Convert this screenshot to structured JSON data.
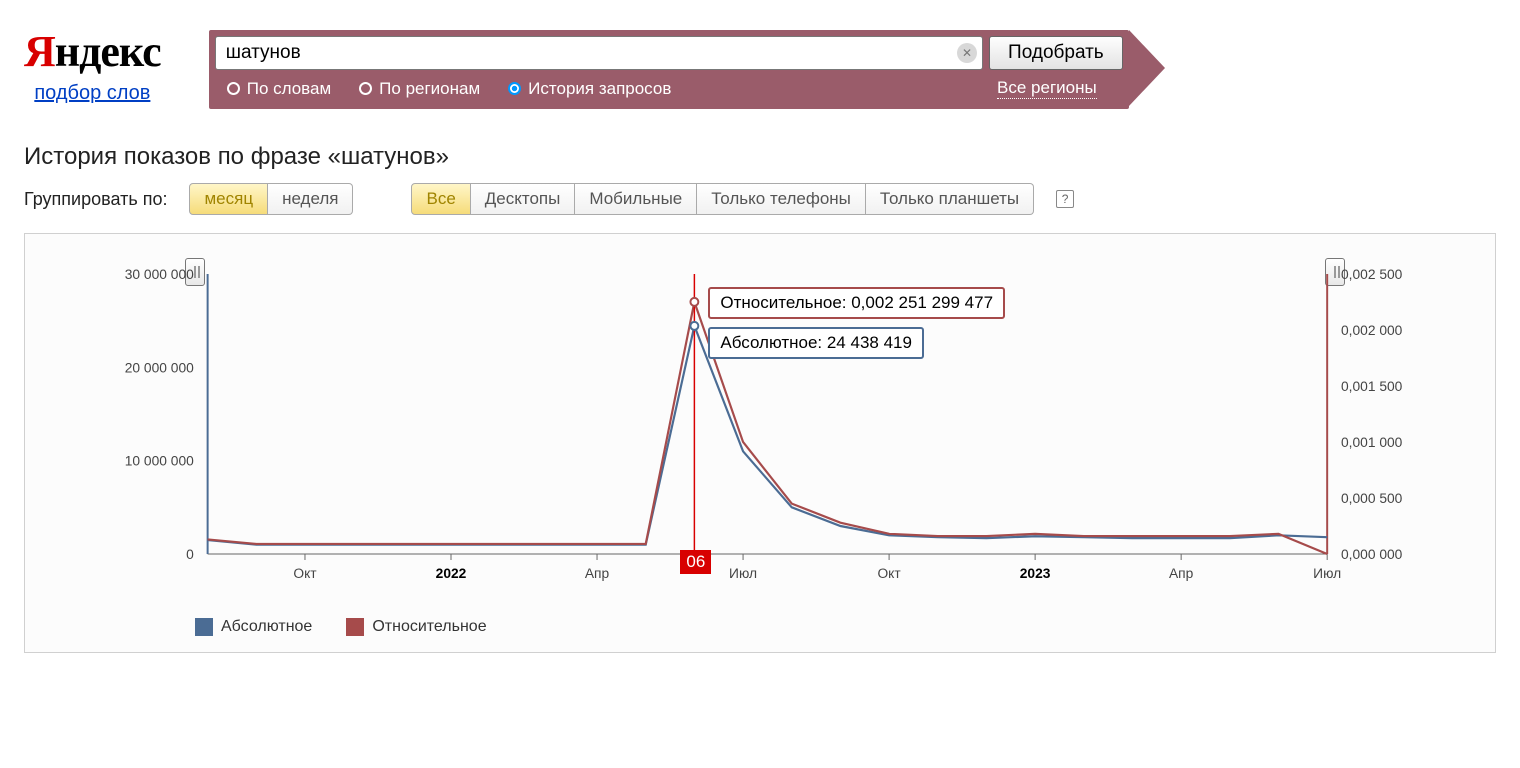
{
  "logo": {
    "part1": "Я",
    "part2": "ндекс",
    "sublink": "подбор слов"
  },
  "search": {
    "value": "шатунов",
    "button": "Подобрать",
    "radios": [
      {
        "label": "По словам",
        "selected": false
      },
      {
        "label": "По регионам",
        "selected": false
      },
      {
        "label": "История запросов",
        "selected": true
      }
    ],
    "region_link": "Все регионы"
  },
  "title": "История показов по фразе «шатунов»",
  "controls": {
    "group_label": "Группировать по:",
    "period": [
      {
        "label": "месяц",
        "active": true
      },
      {
        "label": "неделя",
        "active": false
      }
    ],
    "device": [
      {
        "label": "Все",
        "active": true
      },
      {
        "label": "Десктопы",
        "active": false
      },
      {
        "label": "Мобильные",
        "active": false
      },
      {
        "label": "Только телефоны",
        "active": false
      },
      {
        "label": "Только планшеты",
        "active": false
      }
    ],
    "help": "?"
  },
  "tooltip": {
    "relative_label": "Относительное:",
    "relative_value": "0,002 251 299 477",
    "absolute_label": "Абсолютное:",
    "absolute_value": "24 438 419"
  },
  "month_badge": "06",
  "legend": [
    {
      "color": "blue",
      "label": "Абсолютное"
    },
    {
      "color": "red",
      "label": "Относительное"
    }
  ],
  "chart_axes": {
    "left_ticks": [
      "30 000 000",
      "20 000 000",
      "10 000 000",
      "0"
    ],
    "right_ticks": [
      "0,002 500",
      "0,002 000",
      "0,001 500",
      "0,001 000",
      "0,000 500",
      "0,000 000"
    ],
    "x_ticks": [
      "Окт",
      "2022",
      "Апр",
      "Июл",
      "Окт",
      "2023",
      "Апр",
      "Июл"
    ]
  },
  "chart_data": {
    "type": "line",
    "title": "История показов по фразе «шатунов»",
    "x": [
      "2021-08",
      "2021-09",
      "2021-10",
      "2021-11",
      "2021-12",
      "2022-01",
      "2022-02",
      "2022-03",
      "2022-04",
      "2022-05",
      "2022-06",
      "2022-07",
      "2022-08",
      "2022-09",
      "2022-10",
      "2022-11",
      "2022-12",
      "2023-01",
      "2023-02",
      "2023-03",
      "2023-04",
      "2023-05",
      "2023-06",
      "2023-07"
    ],
    "series": [
      {
        "name": "Абсолютное",
        "axis": "left",
        "values": [
          1500000,
          1000000,
          1000000,
          1000000,
          1000000,
          1000000,
          1000000,
          1000000,
          1000000,
          1000000,
          24438419,
          11000000,
          5000000,
          3000000,
          2000000,
          1800000,
          1700000,
          1900000,
          1800000,
          1700000,
          1700000,
          1700000,
          2000000,
          1800000
        ]
      },
      {
        "name": "Относительное",
        "axis": "right",
        "values": [
          0.00013,
          9e-05,
          9e-05,
          9e-05,
          9e-05,
          9e-05,
          9e-05,
          9e-05,
          9e-05,
          9e-05,
          0.002251299477,
          0.001,
          0.00045,
          0.00028,
          0.00018,
          0.00016,
          0.00016,
          0.00018,
          0.00016,
          0.00016,
          0.00016,
          0.00016,
          0.00018,
          0.0
        ]
      }
    ],
    "ylim_left": [
      0,
      30000000
    ],
    "ylim_right": [
      0,
      0.0025
    ],
    "highlight_index": 10,
    "x_tick_labels": [
      "Окт",
      "2022",
      "Апр",
      "Июл",
      "Окт",
      "2023",
      "Апр",
      "Июл"
    ]
  }
}
